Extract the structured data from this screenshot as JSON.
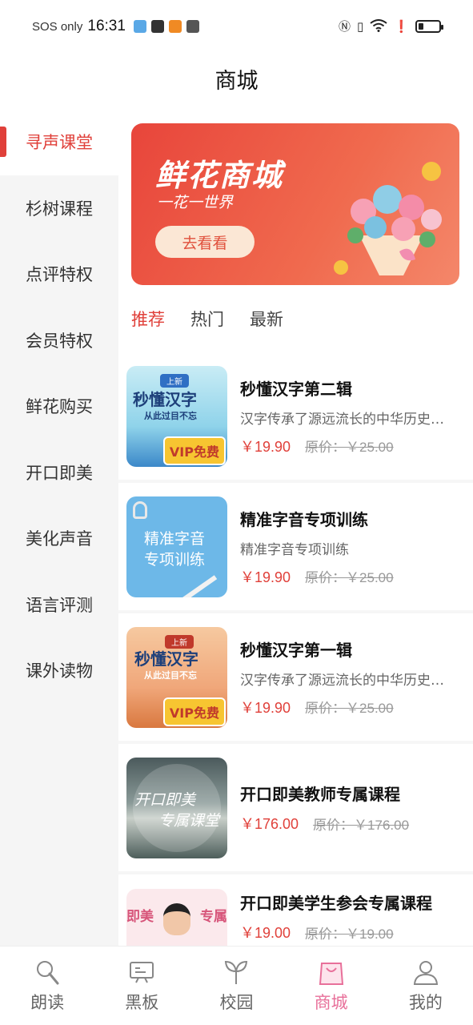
{
  "status_bar": {
    "carrier": "SOS only",
    "time": "16:31"
  },
  "header": {
    "title": "商城"
  },
  "sidebar": {
    "items": [
      {
        "label": "寻声课堂",
        "active": true
      },
      {
        "label": "杉树课程",
        "active": false
      },
      {
        "label": "点评特权",
        "active": false
      },
      {
        "label": "会员特权",
        "active": false
      },
      {
        "label": "鲜花购买",
        "active": false
      },
      {
        "label": "开口即美",
        "active": false
      },
      {
        "label": "美化声音",
        "active": false
      },
      {
        "label": "语言评测",
        "active": false
      },
      {
        "label": "课外读物",
        "active": false
      }
    ]
  },
  "banner": {
    "title": "鲜花商城",
    "subtitle": "一花一世界",
    "button": "去看看"
  },
  "tabs": [
    {
      "label": "推荐",
      "active": true
    },
    {
      "label": "热门",
      "active": false
    },
    {
      "label": "最新",
      "active": false
    }
  ],
  "products": [
    {
      "title": "秒懂汉字第二辑",
      "desc": "汉字传承了源远流长的中华历史文化",
      "price": "￥19.90",
      "orig": "原价：￥25.00",
      "thumb_text": "秒懂汉字",
      "thumb_sub": "从此过目不忘",
      "badge": "VIP免费",
      "tag": "上新"
    },
    {
      "title": "精准字音专项训练",
      "desc": "精准字音专项训练",
      "price": "￥19.90",
      "orig": "原价：￥25.00",
      "thumb_text": "精准字音",
      "thumb_sub": "专项训练"
    },
    {
      "title": "秒懂汉字第一辑",
      "desc": "汉字传承了源远流长的中华历史文化",
      "price": "￥19.90",
      "orig": "原价：￥25.00",
      "thumb_text": "秒懂汉字",
      "thumb_sub": "从此过目不忘",
      "badge": "VIP免费",
      "tag": "上新"
    },
    {
      "title": "开口即美教师专属课程",
      "desc": "",
      "price": "￥176.00",
      "orig": "原价：￥176.00",
      "thumb_text": "开口即美",
      "thumb_sub": "专属课堂"
    },
    {
      "title": "开口即美学生参会专属课程",
      "desc": "",
      "price": "￥19.00",
      "orig": "原价：￥19.00",
      "thumb_text": "即美",
      "thumb_sub": "专属"
    }
  ],
  "bottom_nav": [
    {
      "label": "朗读",
      "icon": "microphone-icon",
      "active": false
    },
    {
      "label": "黑板",
      "icon": "blackboard-icon",
      "active": false
    },
    {
      "label": "校园",
      "icon": "sprout-icon",
      "active": false
    },
    {
      "label": "商城",
      "icon": "shopping-bag-icon",
      "active": true
    },
    {
      "label": "我的",
      "icon": "user-icon",
      "active": false
    }
  ],
  "colors": {
    "accent": "#e0403a",
    "nav_active": "#e8709a"
  }
}
